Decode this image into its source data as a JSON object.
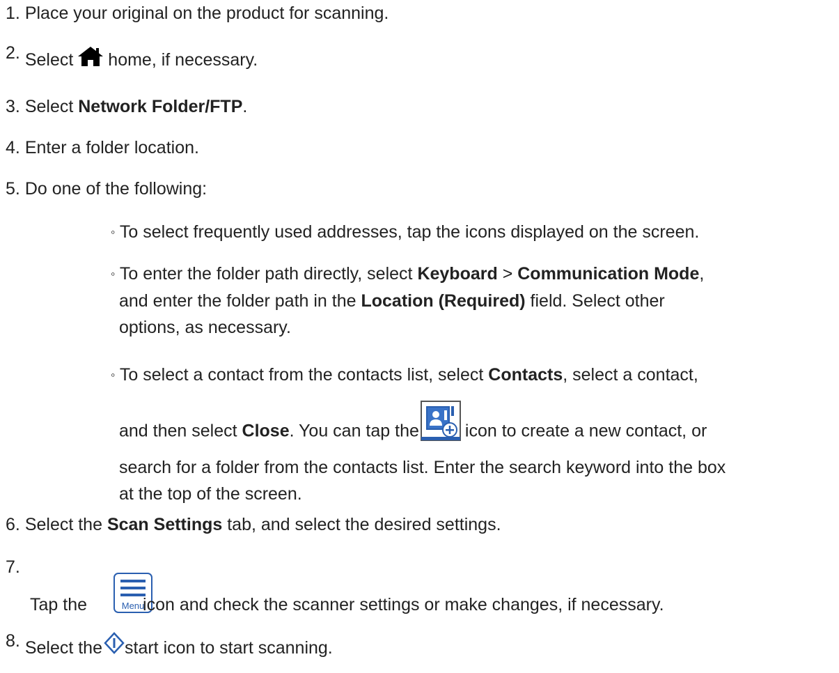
{
  "steps": [
    {
      "num": "1.",
      "parts": [
        "Place your original on the product for scanning."
      ]
    },
    {
      "num": "2.",
      "before": "Select",
      "icon": "home-icon",
      "after": "home, if necessary."
    },
    {
      "num": "3.",
      "before": "Select ",
      "bold": "Network Folder/FTP",
      "after": "."
    },
    {
      "num": "4.",
      "text": "Enter a folder location."
    },
    {
      "num": "5.",
      "text": "Do one of the following:"
    },
    {
      "num": "6.",
      "before": "Select the ",
      "bold": "Scan Settings",
      "after": " tab, and select the desired settings."
    },
    {
      "num": "7.",
      "before": "Tap the",
      "icon": "menu-icon",
      "after": "icon and check the scanner settings or make changes, if necessary."
    },
    {
      "num": "8.",
      "before": "Select the",
      "icon": "start-icon",
      "after": "start icon to start scanning."
    }
  ],
  "bullets": {
    "mark": "◦",
    "b1": "To select frequently used addresses, tap the icons displayed on the screen.",
    "b2_a": "To enter the folder path directly, select ",
    "b2_bold1": "Keyboard",
    "b2_sep": " > ",
    "b2_bold2": "Communication Mode",
    "b2_b": ",",
    "b2_c": "and enter the folder path in the ",
    "b2_bold3": "Location (Required)",
    "b2_d": " field. Select other",
    "b2_e": "options, as necessary.",
    "b3_a": "To select a contact from the contacts list, select ",
    "b3_bold1": "Contacts",
    "b3_b": ", select a contact,",
    "b3_c": "and then select ",
    "b3_bold2": "Close",
    "b3_d": ". You can tap the",
    "b3_e": "icon to create a new contact, or",
    "b3_f": "search for a folder from the contacts list. Enter the search keyword into the box",
    "b3_g": "at the top of the screen."
  },
  "icons": {
    "menu_label": "Menu",
    "home": "home-icon",
    "contact_add": "contact-add-icon",
    "menu": "menu-icon",
    "start": "start-icon"
  },
  "colors": {
    "text": "#222222",
    "icon_blue": "#2a5fb0",
    "icon_border": "#555555"
  }
}
